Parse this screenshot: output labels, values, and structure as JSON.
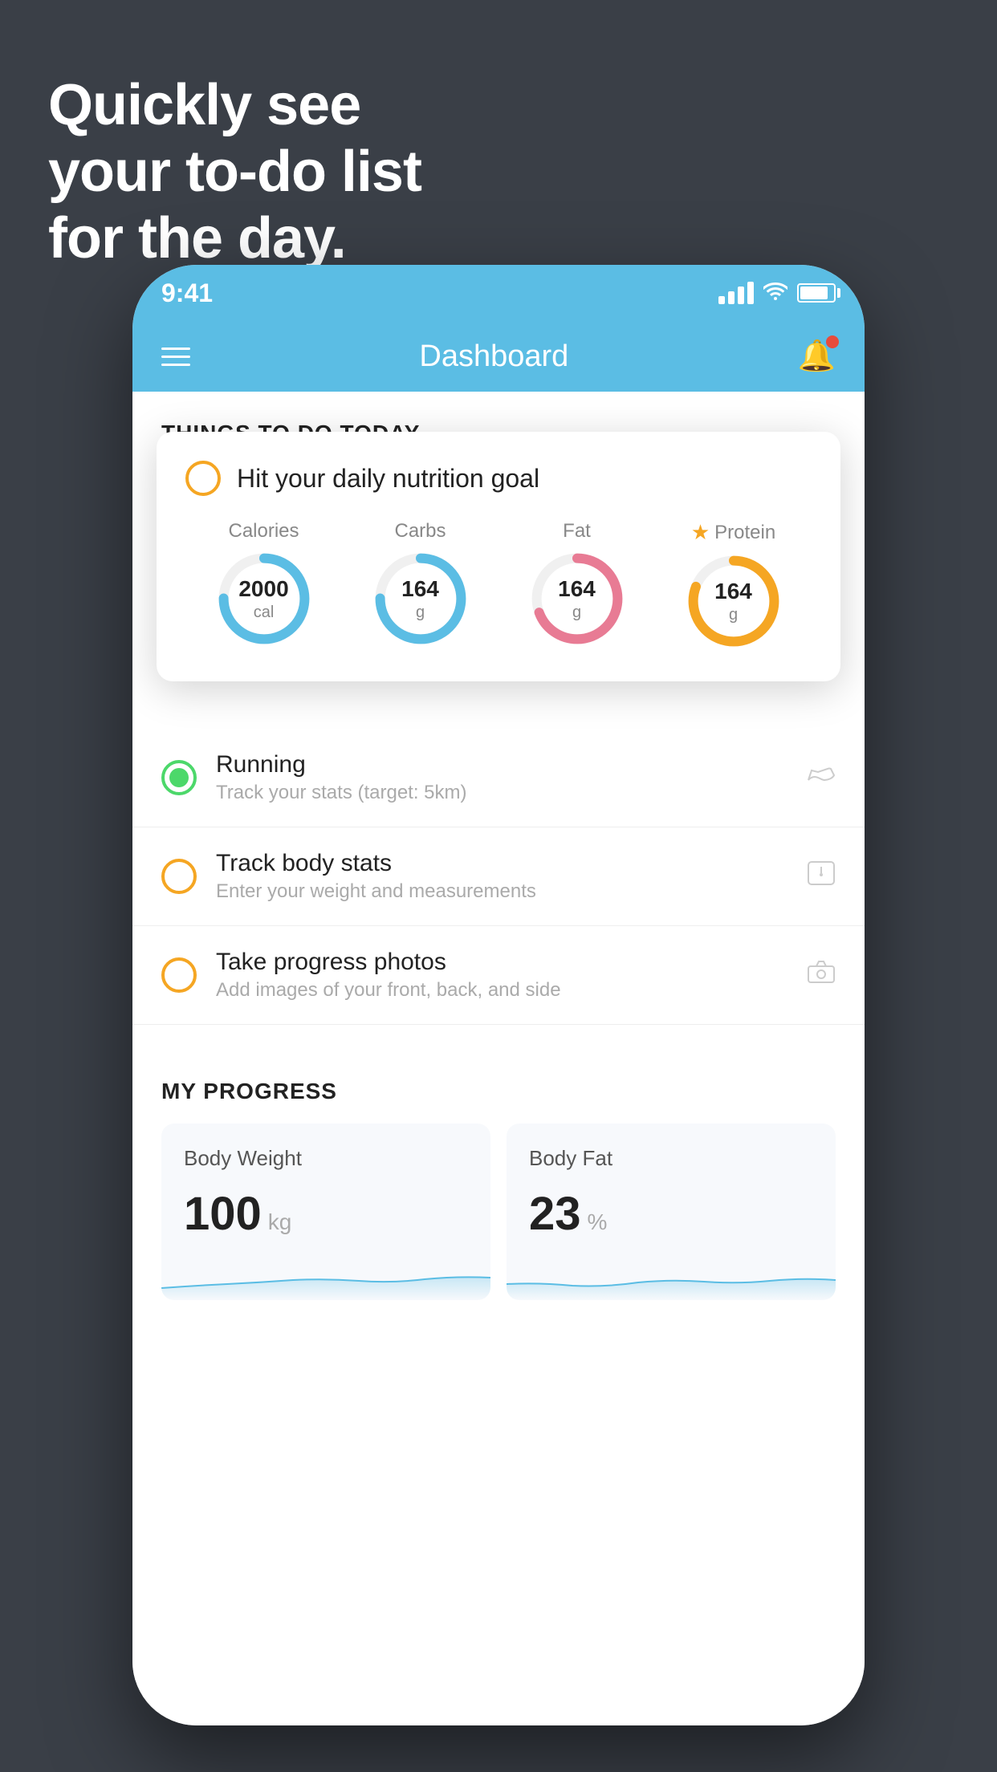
{
  "hero": {
    "line1": "Quickly see",
    "line2": "your to-do list",
    "line3": "for the day."
  },
  "status_bar": {
    "time": "9:41"
  },
  "nav": {
    "title": "Dashboard"
  },
  "things_to_do": {
    "header": "THINGS TO DO TODAY",
    "nutrition_card": {
      "title": "Hit your daily nutrition goal",
      "metrics": [
        {
          "label": "Calories",
          "value": "2000",
          "unit": "cal",
          "ring": "blue",
          "star": false
        },
        {
          "label": "Carbs",
          "value": "164",
          "unit": "g",
          "ring": "blue",
          "star": false
        },
        {
          "label": "Fat",
          "value": "164",
          "unit": "g",
          "ring": "pink",
          "star": false
        },
        {
          "label": "Protein",
          "value": "164",
          "unit": "g",
          "ring": "yellow",
          "star": true
        }
      ]
    },
    "items": [
      {
        "title": "Running",
        "subtitle": "Track your stats (target: 5km)",
        "completed": true,
        "icon": "shoe"
      },
      {
        "title": "Track body stats",
        "subtitle": "Enter your weight and measurements",
        "completed": false,
        "icon": "scale"
      },
      {
        "title": "Take progress photos",
        "subtitle": "Add images of your front, back, and side",
        "completed": false,
        "icon": "camera"
      }
    ]
  },
  "my_progress": {
    "header": "MY PROGRESS",
    "cards": [
      {
        "title": "Body Weight",
        "value": "100",
        "unit": "kg"
      },
      {
        "title": "Body Fat",
        "value": "23",
        "unit": "%"
      }
    ]
  }
}
